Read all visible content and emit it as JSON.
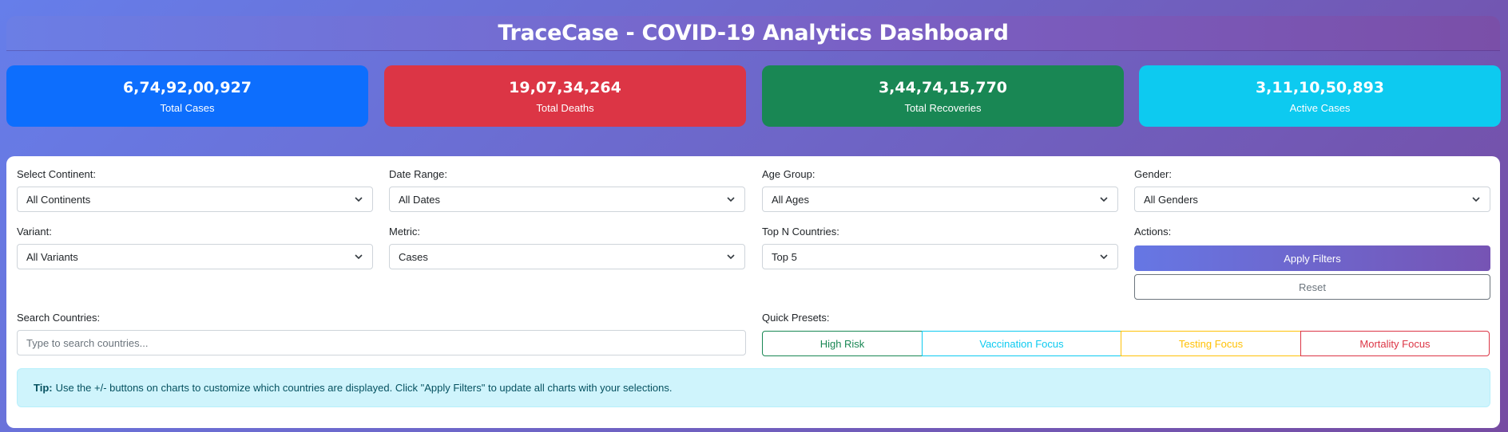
{
  "header": {
    "title": "TraceCase - COVID-19 Analytics Dashboard"
  },
  "stats": [
    {
      "value": "6,74,92,00,927",
      "label": "Total Cases",
      "color": "#0d6efd"
    },
    {
      "value": "19,07,34,264",
      "label": "Total Deaths",
      "color": "#dc3545"
    },
    {
      "value": "3,44,74,15,770",
      "label": "Total Recoveries",
      "color": "#198754"
    },
    {
      "value": "3,11,10,50,893",
      "label": "Active Cases",
      "color": "#0dcaf0"
    }
  ],
  "filters": {
    "continent": {
      "label": "Select Continent:",
      "value": "All Continents"
    },
    "date_range": {
      "label": "Date Range:",
      "value": "All Dates"
    },
    "age_group": {
      "label": "Age Group:",
      "value": "All Ages"
    },
    "gender": {
      "label": "Gender:",
      "value": "All Genders"
    },
    "variant": {
      "label": "Variant:",
      "value": "All Variants"
    },
    "metric": {
      "label": "Metric:",
      "value": "Cases"
    },
    "top_n": {
      "label": "Top N Countries:",
      "value": "Top 5"
    },
    "actions": {
      "label": "Actions:",
      "apply": "Apply Filters",
      "reset": "Reset"
    },
    "search": {
      "label": "Search Countries:",
      "placeholder": "Type to search countries..."
    },
    "presets": {
      "label": "Quick Presets:",
      "high_risk": "High Risk",
      "vaccination": "Vaccination Focus",
      "testing": "Testing Focus",
      "mortality": "Mortality Focus"
    }
  },
  "tip": {
    "prefix": "Tip:",
    "text": "Use the +/- buttons on charts to customize which countries are displayed. Click \"Apply Filters\" to update all charts with your selections."
  },
  "colors": {
    "primary": "#0d6efd",
    "danger": "#dc3545",
    "success": "#198754",
    "info": "#0dcaf0",
    "warning": "#ffc107",
    "accent_gradient_start": "#667eea",
    "accent_gradient_end": "#764ba2"
  }
}
